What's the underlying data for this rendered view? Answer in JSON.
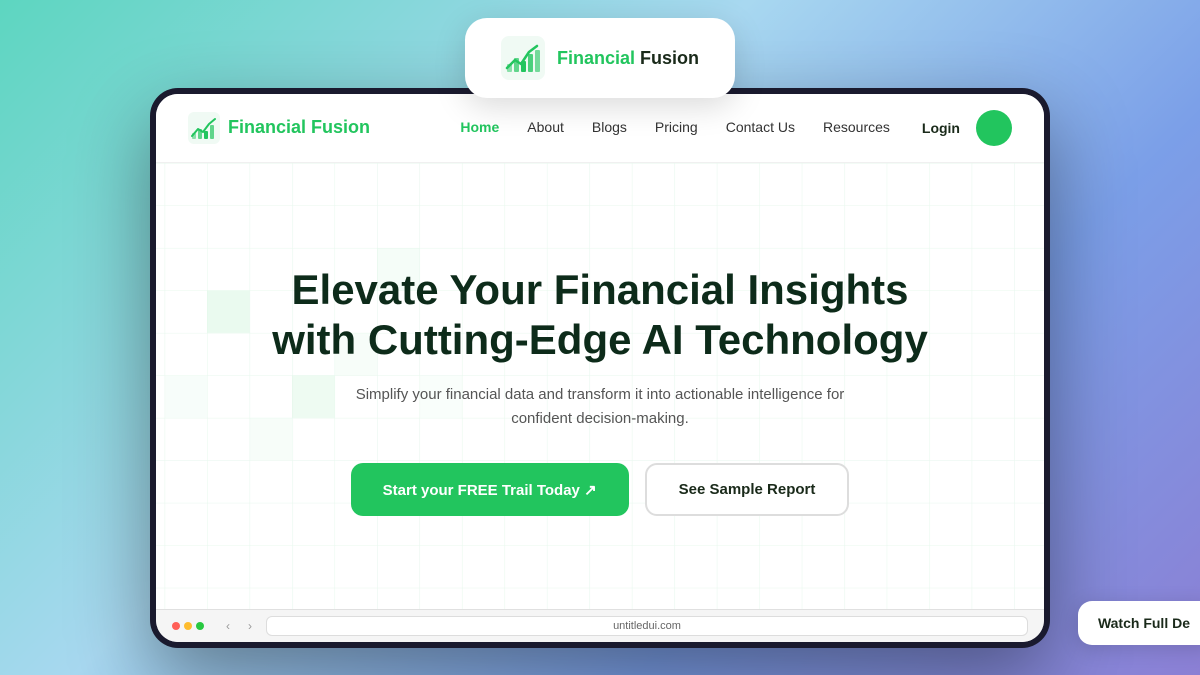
{
  "background": {
    "gradient_start": "#5dd6c0",
    "gradient_end": "#8b7fd4"
  },
  "logo_card": {
    "brand_name_part1": "Financial",
    "brand_name_part2": " Fusion"
  },
  "navbar": {
    "brand_name_part1": "Financial",
    "brand_name_part2": " Fusion",
    "links": [
      {
        "label": "Home",
        "active": true
      },
      {
        "label": "About",
        "active": false
      },
      {
        "label": "Blogs",
        "active": false
      },
      {
        "label": "Pricing",
        "active": false
      },
      {
        "label": "Contact Us",
        "active": false
      },
      {
        "label": "Resources",
        "active": false
      }
    ],
    "login_label": "Login"
  },
  "hero": {
    "title_line1": "Elevate Your Financial Insights",
    "title_line2": "with Cutting-Edge AI Technology",
    "subtitle": "Simplify your financial data and transform it into actionable intelligence for confident decision-making.",
    "cta_primary": "Start your FREE Trail Today ↗",
    "cta_secondary": "See Sample Report"
  },
  "browser_bar": {
    "url": "untitledui.com"
  },
  "watch_demo": {
    "label": "Watch Full De"
  }
}
